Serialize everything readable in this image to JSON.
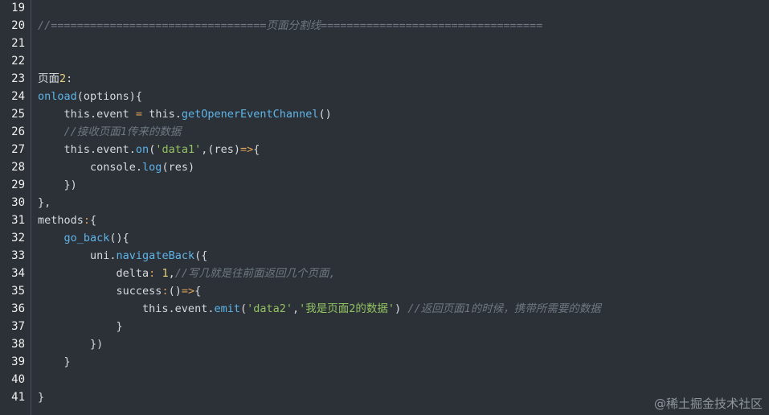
{
  "editor": {
    "lines": [
      {
        "n": "19",
        "tokens": []
      },
      {
        "n": "20",
        "tokens": [
          {
            "t": "//=================================页面分割线==================================",
            "c": "cm"
          }
        ]
      },
      {
        "n": "21",
        "tokens": []
      },
      {
        "n": "22",
        "tokens": []
      },
      {
        "n": "23",
        "tokens": [
          {
            "t": "页面",
            "c": "p"
          },
          {
            "t": "2",
            "c": "num-yellow"
          },
          {
            "t": ":",
            "c": "p"
          }
        ]
      },
      {
        "n": "24",
        "tokens": [
          {
            "t": "onload",
            "c": "fn"
          },
          {
            "t": "(options){",
            "c": "p"
          }
        ]
      },
      {
        "n": "25",
        "tokens": [
          {
            "t": "    this.event ",
            "c": "p"
          },
          {
            "t": "=",
            "c": "op"
          },
          {
            "t": " this.",
            "c": "p"
          },
          {
            "t": "getOpenerEventChannel",
            "c": "fn"
          },
          {
            "t": "()",
            "c": "p"
          }
        ]
      },
      {
        "n": "26",
        "tokens": [
          {
            "t": "    ",
            "c": "p"
          },
          {
            "t": "//接收页面1传来的数据",
            "c": "cm"
          }
        ]
      },
      {
        "n": "27",
        "tokens": [
          {
            "t": "    this.event.",
            "c": "p"
          },
          {
            "t": "on",
            "c": "fn"
          },
          {
            "t": "(",
            "c": "p"
          },
          {
            "t": "'data1'",
            "c": "str"
          },
          {
            "t": ",(res)",
            "c": "p"
          },
          {
            "t": "=>",
            "c": "op"
          },
          {
            "t": "{",
            "c": "p"
          }
        ]
      },
      {
        "n": "28",
        "tokens": [
          {
            "t": "        console.",
            "c": "p"
          },
          {
            "t": "log",
            "c": "fn"
          },
          {
            "t": "(res)",
            "c": "p"
          }
        ]
      },
      {
        "n": "29",
        "tokens": [
          {
            "t": "    })",
            "c": "p"
          }
        ]
      },
      {
        "n": "30",
        "tokens": [
          {
            "t": "},",
            "c": "p"
          }
        ]
      },
      {
        "n": "31",
        "tokens": [
          {
            "t": "methods",
            "c": "p"
          },
          {
            "t": ":",
            "c": "op"
          },
          {
            "t": "{",
            "c": "p"
          }
        ]
      },
      {
        "n": "32",
        "tokens": [
          {
            "t": "    ",
            "c": "p"
          },
          {
            "t": "go_back",
            "c": "fn"
          },
          {
            "t": "(){",
            "c": "p"
          }
        ]
      },
      {
        "n": "33",
        "tokens": [
          {
            "t": "        uni.",
            "c": "p"
          },
          {
            "t": "navigateBack",
            "c": "fn"
          },
          {
            "t": "({",
            "c": "p"
          }
        ]
      },
      {
        "n": "34",
        "tokens": [
          {
            "t": "            delta",
            "c": "p"
          },
          {
            "t": ":",
            "c": "op"
          },
          {
            "t": " ",
            "c": "p"
          },
          {
            "t": "1",
            "c": "num-yellow"
          },
          {
            "t": ",",
            "c": "p"
          },
          {
            "t": "//写几就是往前面返回几个页面,",
            "c": "cm"
          }
        ]
      },
      {
        "n": "35",
        "tokens": [
          {
            "t": "            success",
            "c": "p"
          },
          {
            "t": ":",
            "c": "op"
          },
          {
            "t": "()",
            "c": "p"
          },
          {
            "t": "=>",
            "c": "op"
          },
          {
            "t": "{",
            "c": "p"
          }
        ]
      },
      {
        "n": "36",
        "tokens": [
          {
            "t": "                this.event.",
            "c": "p"
          },
          {
            "t": "emit",
            "c": "fn"
          },
          {
            "t": "(",
            "c": "p"
          },
          {
            "t": "'data2'",
            "c": "str"
          },
          {
            "t": ",",
            "c": "p"
          },
          {
            "t": "'我是页面2的数据'",
            "c": "str"
          },
          {
            "t": ") ",
            "c": "p"
          },
          {
            "t": "//返回页面1的时候，携带所需要的数据",
            "c": "cm"
          }
        ]
      },
      {
        "n": "37",
        "tokens": [
          {
            "t": "            }",
            "c": "p"
          }
        ]
      },
      {
        "n": "38",
        "tokens": [
          {
            "t": "        })",
            "c": "p"
          }
        ]
      },
      {
        "n": "39",
        "tokens": [
          {
            "t": "    }",
            "c": "p"
          }
        ]
      },
      {
        "n": "40",
        "tokens": []
      },
      {
        "n": "41",
        "tokens": [
          {
            "t": "}",
            "c": "p"
          }
        ]
      }
    ]
  },
  "watermark": "@稀土掘金技术社区"
}
